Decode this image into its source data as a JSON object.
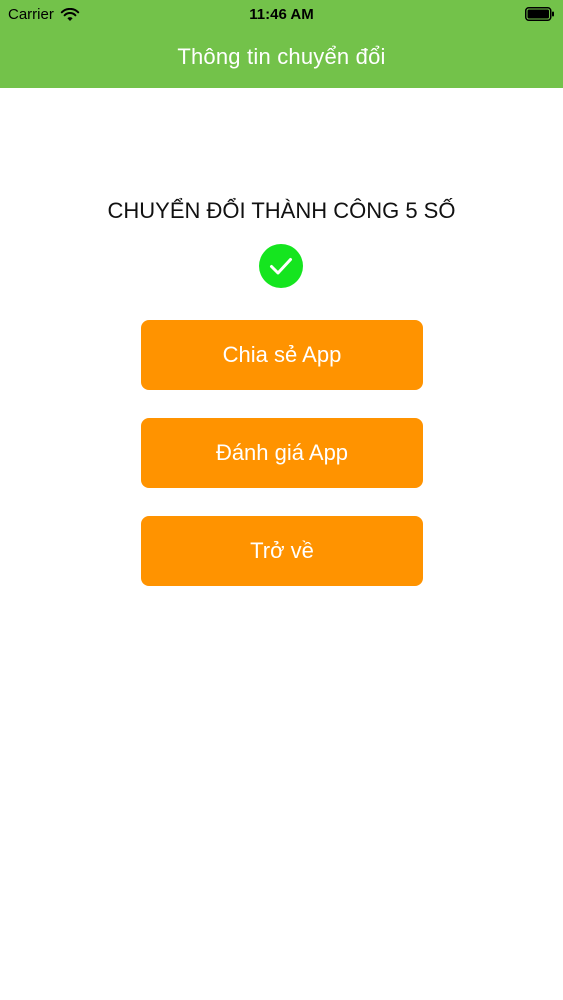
{
  "status_bar": {
    "carrier": "Carrier",
    "time": "11:46 AM"
  },
  "nav": {
    "title": "Thông tin chuyển đổi"
  },
  "result": {
    "message": "CHUYỂN ĐỔI THÀNH CÔNG 5 SỐ",
    "icon": "check-circle-icon"
  },
  "buttons": {
    "share_label": "Chia sẻ App",
    "rate_label": "Đánh giá App",
    "back_label": "Trở về"
  },
  "colors": {
    "header": "#73c24a",
    "button": "#ff9300",
    "check": "#15e51f"
  }
}
